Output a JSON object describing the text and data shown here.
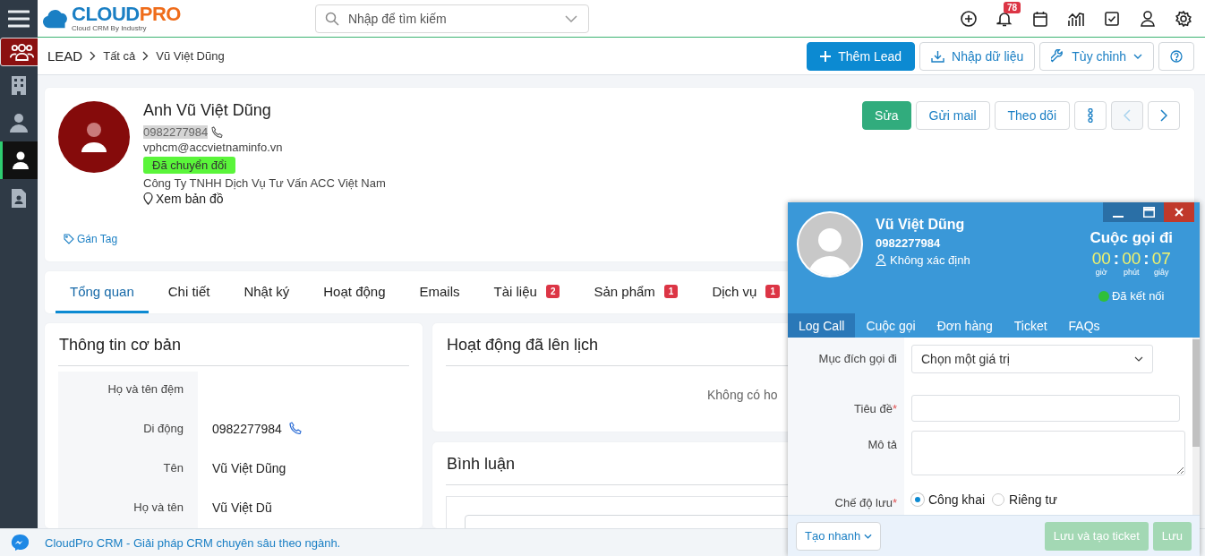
{
  "sidebar": {
    "items": [
      {
        "kind": "people",
        "selected": true,
        "highlighted": false
      },
      {
        "kind": "building",
        "selected": false,
        "highlighted": false
      },
      {
        "kind": "contacts",
        "selected": false,
        "highlighted": false
      },
      {
        "kind": "person",
        "selected": false,
        "highlighted": true
      },
      {
        "kind": "document",
        "selected": false,
        "highlighted": false
      }
    ]
  },
  "logo": {
    "text": "CLOUD",
    "accent": "PRO",
    "tagline": "Cloud CRM By Industry"
  },
  "search": {
    "placeholder": "Nhập để tìm kiếm"
  },
  "notification_count": "78",
  "breadcrumb": [
    "LEAD",
    "Tất cả",
    "Vũ Việt Dũng"
  ],
  "page_actions": [
    {
      "kind": "primary",
      "label": "Thêm Lead"
    },
    {
      "kind": "import",
      "label": "Nhập dữ liệu"
    },
    {
      "kind": "menu",
      "label": "Tùy chỉnh"
    },
    {
      "kind": "help"
    }
  ],
  "profile": {
    "name": "Anh Vũ Việt Dũng",
    "phone": "0982277984",
    "email": "vphcm@accvietnaminfo.vn",
    "status": "Đã chuyển đổi",
    "company": "Công Ty TNHH Dịch Vụ Tư Vấn ACC Việt Nam",
    "map_link": "Xem bản đồ",
    "tag_link": "Gán Tag",
    "actions": [
      {
        "kind": "edit",
        "label": "Sửa"
      },
      {
        "kind": "text",
        "label": "Gửi mail"
      },
      {
        "kind": "text",
        "label": "Theo dõi"
      },
      {
        "kind": "more"
      },
      {
        "kind": "prev",
        "disabled": true
      },
      {
        "kind": "next",
        "disabled": false
      }
    ]
  },
  "tabs": [
    {
      "label": "Tổng quan",
      "selected": true
    },
    {
      "label": "Chi tiết",
      "selected": false
    },
    {
      "label": "Nhật ký",
      "selected": false
    },
    {
      "label": "Hoạt động",
      "selected": false
    },
    {
      "label": "Emails",
      "selected": false
    },
    {
      "label": "Tài liệu",
      "badge": "2",
      "selected": false
    },
    {
      "label": "Sản phẩm",
      "badge": "1",
      "selected": false
    },
    {
      "label": "Dịch vụ",
      "badge": "1",
      "selected": false
    }
  ],
  "basic_info": {
    "title": "Thông tin cơ bản",
    "rows": [
      {
        "label": "Họ và tên đệm"
      },
      {
        "label": "Di động",
        "value": "0982277984",
        "kind": "phone"
      },
      {
        "label": "Tên",
        "value": "Vũ Việt Dũng"
      },
      {
        "label": "Họ và tên",
        "value": "Vũ Việt Dũ"
      }
    ]
  },
  "scheduled": {
    "title": "Hoạt động đã lên lịch",
    "empty_text": "Không có ho"
  },
  "comments": {
    "title": "Bình luận"
  },
  "footer": {
    "text": "CloudPro CRM - Giải pháp CRM chuyên sâu theo ngành."
  },
  "call_popup": {
    "name": "Vũ Việt Dũng",
    "phone": "0982277984",
    "owner": "Không xác định",
    "direction": "Cuộc gọi đi",
    "timer_separator": ":",
    "required_mark": "*",
    "timer": [
      {
        "value": "00",
        "unit": "giờ"
      },
      {
        "value": "00",
        "unit": "phút"
      },
      {
        "value": "07",
        "unit": "giây"
      }
    ],
    "status": "Đã kết nối",
    "connected": true,
    "tabs": [
      {
        "label": "Log Call",
        "selected": true
      },
      {
        "label": "Cuộc gọi",
        "selected": false
      },
      {
        "label": "Đơn hàng",
        "selected": false
      },
      {
        "label": "Ticket",
        "selected": false
      },
      {
        "label": "FAQs",
        "selected": false
      }
    ],
    "fields": [
      {
        "kind": "select",
        "label": "Mục đích gọi đi",
        "value": "Chọn một giá trị",
        "required": false
      },
      {
        "kind": "text",
        "label": "Tiêu đề",
        "required": true
      },
      {
        "kind": "textarea",
        "label": "Mô tả",
        "required": false
      },
      {
        "kind": "radio",
        "label": "Chế độ lưu",
        "required": true,
        "options": [
          {
            "label": "Công khai",
            "selected": true
          },
          {
            "label": "Riêng tư",
            "selected": false
          }
        ]
      }
    ],
    "quick_create": "Tạo nhanh",
    "buttons": [
      {
        "label": "Lưu và tạo ticket",
        "disabled": true
      },
      {
        "label": "Lưu",
        "disabled": true
      }
    ]
  }
}
